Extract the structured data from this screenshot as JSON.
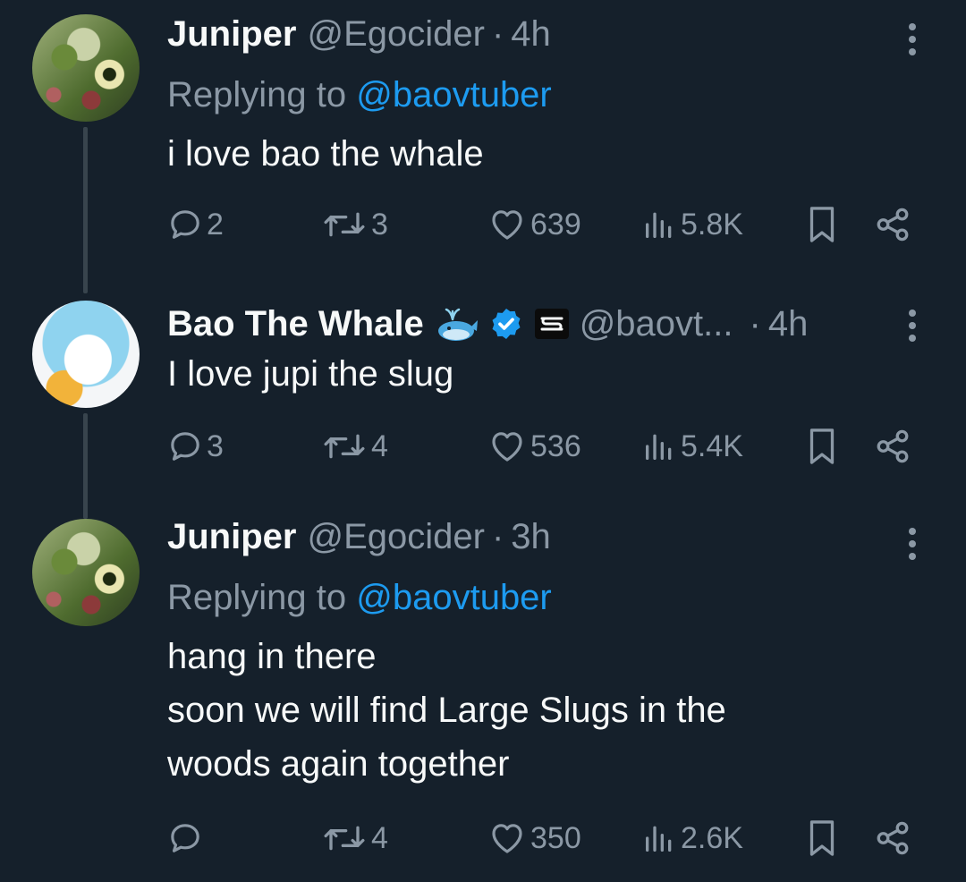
{
  "tweets": [
    {
      "display_name": "Juniper",
      "handle": "@Egocider",
      "time": "4h",
      "replying_prefix": "Replying to ",
      "replying_to": "@baovtuber",
      "text": "i love bao the whale",
      "replies": "2",
      "retweets": "3",
      "likes": "639",
      "views": "5.8K"
    },
    {
      "display_name": "Bao The Whale",
      "handle": "@baovt...",
      "time": "4h",
      "text": "I love jupi the slug",
      "replies": "3",
      "retweets": "4",
      "likes": "536",
      "views": "5.4K"
    },
    {
      "display_name": "Juniper",
      "handle": "@Egocider",
      "time": "3h",
      "replying_prefix": "Replying to ",
      "replying_to": "@baovtuber",
      "text": "hang in there\nsoon we will find Large Slugs in the\nwoods again together",
      "replies": "",
      "retweets": "4",
      "likes": "350",
      "views": "2.6K"
    }
  ],
  "separator": "·",
  "colors": {
    "background": "#15202b",
    "text_primary": "#f7f9f9",
    "text_secondary": "#8b98a5",
    "link": "#1d9bf0",
    "thread_line": "#38444d",
    "verified": "#1d9bf0"
  },
  "icons": [
    "reply-icon",
    "retweet-icon",
    "like-icon",
    "views-icon",
    "bookmark-icon",
    "share-icon",
    "more-icon",
    "whale-emoji-icon",
    "verified-badge-icon",
    "affiliate-badge-icon"
  ]
}
